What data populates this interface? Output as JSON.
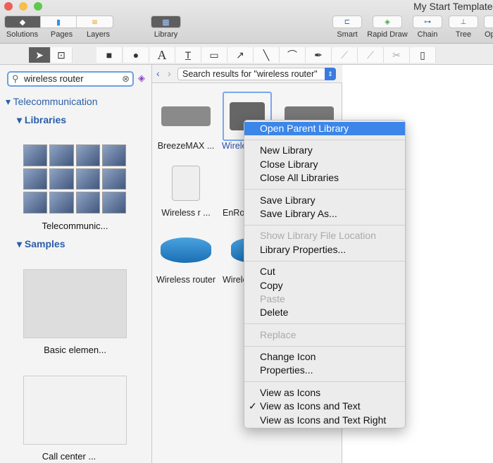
{
  "window": {
    "title": "My Start Template"
  },
  "toolbar": {
    "segments": [
      {
        "label": "Solutions",
        "icon": "solutions-icon",
        "active": true
      },
      {
        "label": "Pages",
        "icon": "pages-icon"
      },
      {
        "label": "Layers",
        "icon": "layers-icon"
      }
    ],
    "library": {
      "label": "Library",
      "icon": "library-icon"
    },
    "right_buttons": [
      {
        "label": "Smart"
      },
      {
        "label": "Rapid Draw"
      },
      {
        "label": "Chain"
      },
      {
        "label": "Tree"
      },
      {
        "label": "Op"
      }
    ]
  },
  "tools": [
    "pointer-icon",
    "text-select-icon",
    "rectangle-icon",
    "ellipse-icon",
    "text-icon",
    "text-box-icon",
    "callout-icon",
    "arrow-icon",
    "line-icon",
    "arc-icon",
    "pen-icon",
    "edit-points-icon",
    "add-point-icon",
    "split-icon",
    "container-icon"
  ],
  "sidebar": {
    "search": {
      "value": "wireless router"
    },
    "group": "Telecommunication",
    "libraries_label": "Libraries",
    "library_name": "Telecommunic...",
    "samples_label": "Samples",
    "samples": [
      {
        "label": "Basic elemen..."
      },
      {
        "label": "Call center ..."
      }
    ]
  },
  "library_panel": {
    "dropdown": "Search results for \"wireless router\"",
    "items": [
      {
        "label": "BreezeMAX ..."
      },
      {
        "label": "Wirele",
        "selected": true
      },
      {
        "label": ""
      },
      {
        "label": "Wireless r ..."
      },
      {
        "label": "EnRo"
      },
      {
        "label": "Wireless router"
      },
      {
        "label": "Wirele"
      }
    ]
  },
  "context_menu": {
    "items": [
      {
        "label": "Open Parent Library",
        "highlighted": true
      },
      "-",
      {
        "label": "New Library"
      },
      {
        "label": "Close Library"
      },
      {
        "label": "Close All Libraries"
      },
      "-",
      {
        "label": "Save Library"
      },
      {
        "label": "Save Library As..."
      },
      "-",
      {
        "label": "Show Library File Location",
        "disabled": true
      },
      {
        "label": "Library Properties..."
      },
      "-",
      {
        "label": "Cut"
      },
      {
        "label": "Copy"
      },
      {
        "label": "Paste",
        "disabled": true
      },
      {
        "label": "Delete"
      },
      "-",
      {
        "label": "Replace",
        "disabled": true
      },
      "-",
      {
        "label": "Change Icon"
      },
      {
        "label": "Properties..."
      },
      "-",
      {
        "label": "View as Icons"
      },
      {
        "label": "View as Icons and Text",
        "checked": true
      },
      {
        "label": "View as Icons and Text Right"
      }
    ]
  }
}
